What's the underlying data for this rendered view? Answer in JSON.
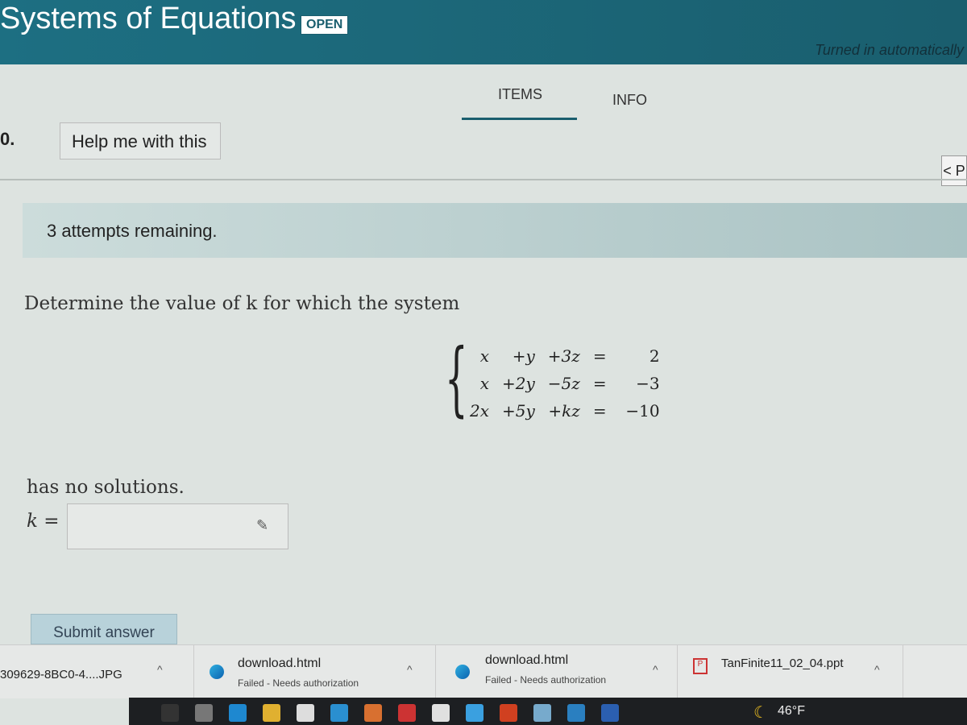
{
  "header": {
    "title": "Systems of Equations",
    "badge": "OPEN",
    "turned_in": "Turned in automatically"
  },
  "tabs": [
    {
      "label": "ITEMS",
      "active": true
    },
    {
      "label": "INFO",
      "active": false
    }
  ],
  "question": {
    "number": "0.",
    "help_label": "Help me with this",
    "attempts": "3 attempts remaining.",
    "prompt": "Determine the value of k for which the system",
    "condition": "has no solutions.",
    "answer_label": "k =",
    "answer_value": "",
    "submit_label": "Submit answer",
    "prev_label": "< P"
  },
  "system": [
    [
      "x",
      "+y",
      "+3z",
      "=",
      "2"
    ],
    [
      "x",
      "+2y",
      "−5z",
      "=",
      "−3"
    ],
    [
      "2x",
      "+5y",
      "+kz",
      "=",
      "−10"
    ]
  ],
  "downloads": [
    {
      "name": "309629-8BC0-4....JPG",
      "status": ""
    },
    {
      "name": "download.html",
      "status": "Failed - Needs authorization"
    },
    {
      "name": "download.html",
      "status": "Failed - Needs authorization"
    },
    {
      "name": "TanFinite11_02_04.ppt",
      "status": ""
    }
  ],
  "taskbar": {
    "temperature": "46°F",
    "icons": [
      "search-icon",
      "task-view-icon",
      "edge-icon",
      "file-explorer-icon",
      "store-icon",
      "mail-icon",
      "l-app-icon",
      "office-icon",
      "chrome-icon",
      "lightbulb-icon",
      "powerpoint-icon",
      "app-icon",
      "photos-icon",
      "word-icon"
    ]
  },
  "colors": {
    "header": "#1a5e6e",
    "attempts_bar": "#ccdcdb",
    "submit": "#b8d2da"
  }
}
